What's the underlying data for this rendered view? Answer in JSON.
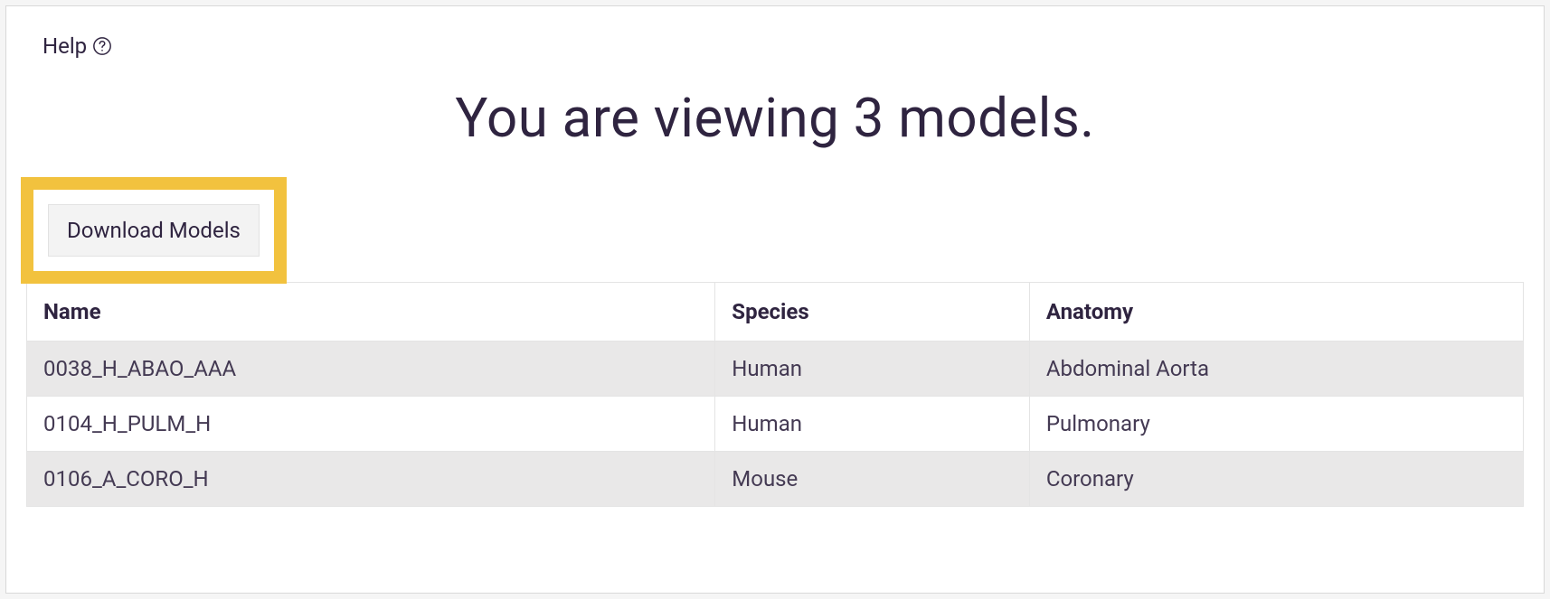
{
  "help": {
    "label": "Help"
  },
  "title": "You are viewing 3 models.",
  "download_button": {
    "label": "Download Models"
  },
  "table": {
    "headers": {
      "name": "Name",
      "species": "Species",
      "anatomy": "Anatomy"
    },
    "rows": [
      {
        "name": "0038_H_ABAO_AAA",
        "species": "Human",
        "anatomy": "Abdominal Aorta"
      },
      {
        "name": "0104_H_PULM_H",
        "species": "Human",
        "anatomy": "Pulmonary"
      },
      {
        "name": "0106_A_CORO_H",
        "species": "Mouse",
        "anatomy": "Coronary"
      }
    ]
  }
}
